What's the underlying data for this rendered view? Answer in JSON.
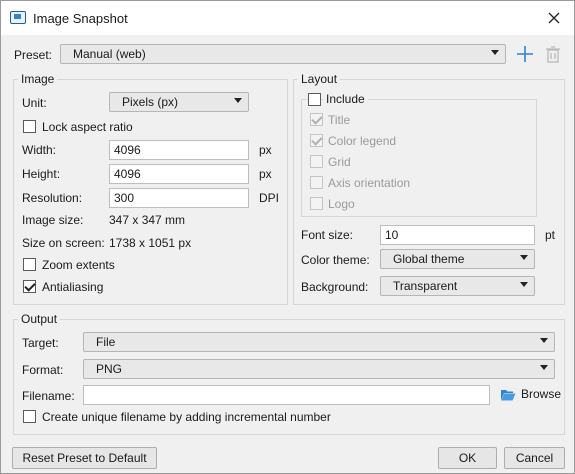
{
  "window": {
    "title": "Image Snapshot"
  },
  "preset": {
    "label": "Preset:",
    "value": "Manual (web)"
  },
  "image_group": {
    "title": "Image",
    "unit_label": "Unit:",
    "unit_value": "Pixels (px)",
    "lock_aspect": "Lock aspect ratio",
    "width_label": "Width:",
    "width_value": "4096",
    "width_unit": "px",
    "height_label": "Height:",
    "height_value": "4096",
    "height_unit": "px",
    "resolution_label": "Resolution:",
    "resolution_value": "300",
    "resolution_unit": "DPI",
    "image_size_label": "Image size:",
    "image_size_value": "347 x 347 mm",
    "size_on_screen_label": "Size on screen:",
    "size_on_screen_value": "1738 x 1051 px",
    "zoom_extents": "Zoom extents",
    "antialiasing": "Antialiasing"
  },
  "layout_group": {
    "title": "Layout",
    "include": "Include",
    "items": [
      "Title",
      "Color legend",
      "Grid",
      "Axis orientation",
      "Logo"
    ],
    "font_size_label": "Font size:",
    "font_size_value": "10",
    "font_size_unit": "pt",
    "color_theme_label": "Color theme:",
    "color_theme_value": "Global theme",
    "background_label": "Background:",
    "background_value": "Transparent"
  },
  "output_group": {
    "title": "Output",
    "target_label": "Target:",
    "target_value": "File",
    "format_label": "Format:",
    "format_value": "PNG",
    "filename_label": "Filename:",
    "filename_value": "",
    "browse": "Browse",
    "unique_filename": "Create unique filename by adding incremental number"
  },
  "buttons": {
    "reset": "Reset Preset to Default",
    "ok": "OK",
    "cancel": "Cancel"
  },
  "colors": {
    "accent": "#2f83d0",
    "folder": "#2f83d0"
  }
}
